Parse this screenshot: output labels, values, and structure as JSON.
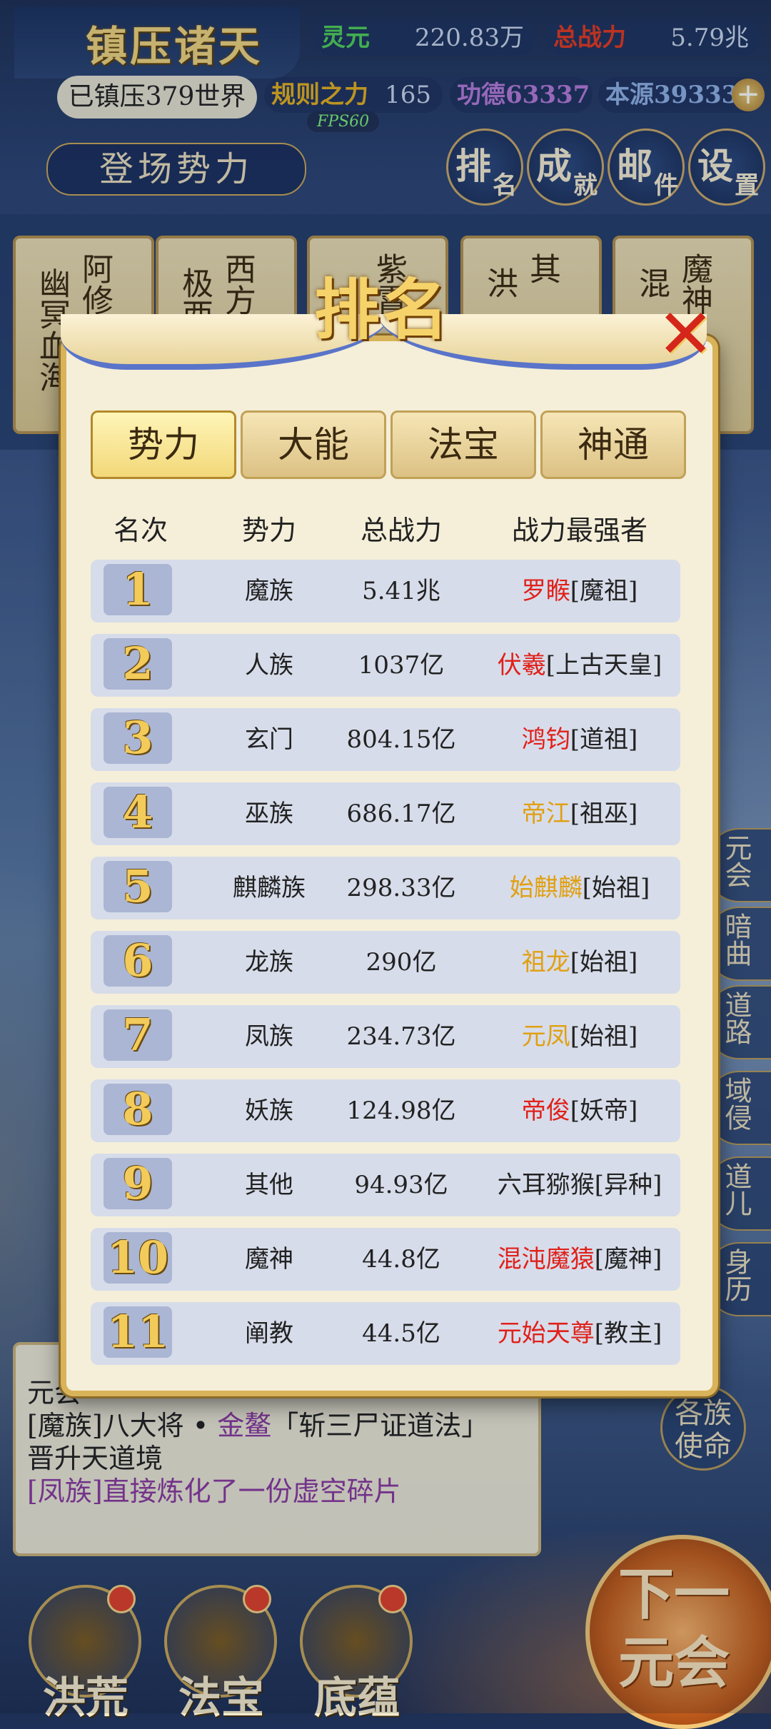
{
  "header": {
    "title": "镇压诸天",
    "suppressed": "已镇压379世界",
    "stats": {
      "lingyuan_label": "灵元",
      "lingyuan_value": "220.83万",
      "total_power_label": "总战力",
      "total_power_value": "5.79兆",
      "rule_label": "规则之力",
      "rule_value": "165",
      "merit": "功德63337",
      "origin": "本源39333"
    },
    "fps": "FPS60",
    "deploy_button": "登场势力",
    "nav": [
      {
        "a": "排",
        "b": "名"
      },
      {
        "a": "成",
        "b": "就"
      },
      {
        "a": "邮",
        "b": "件"
      },
      {
        "a": "设",
        "b": "置"
      }
    ]
  },
  "worlds": [
    {
      "c1": "幽冥血海",
      "c2": "阿修"
    },
    {
      "c1": "极西",
      "c2": "西方"
    },
    {
      "c1": "",
      "c2": "紫霄"
    },
    {
      "c1": "洪",
      "c2": "其"
    },
    {
      "c1": "混",
      "c2": "魔神"
    }
  ],
  "side_buttons": [
    "元会",
    "暗曲",
    "道路",
    "域侵",
    "道儿",
    "身历"
  ],
  "side_big": "各族使命",
  "log": {
    "line1": "[魔族]八大将 • ",
    "line1_name": "金鳌",
    "line1_rest": "「斩三尸证道法」",
    "line2": "晋升天道境",
    "line3": "[凤族]直接炼化了一份虚空碎片",
    "line0": "元会"
  },
  "bottom": [
    "洪荒",
    "法宝",
    "底蕴"
  ],
  "next_button": "下一元会",
  "modal": {
    "title": "排名",
    "tabs": [
      "势力",
      "大能",
      "法宝",
      "神通"
    ],
    "headers": [
      "名次",
      "势力",
      "总战力",
      "战力最强者"
    ],
    "rows": [
      {
        "rank": "1",
        "force": "魔族",
        "power": "5.41兆",
        "name": "罗睺",
        "title": "[魔祖]",
        "color": "red"
      },
      {
        "rank": "2",
        "force": "人族",
        "power": "1037亿",
        "name": "伏羲",
        "title": "[上古天皇]",
        "color": "red"
      },
      {
        "rank": "3",
        "force": "玄门",
        "power": "804.15亿",
        "name": "鸿钧",
        "title": "[道祖]",
        "color": "red"
      },
      {
        "rank": "4",
        "force": "巫族",
        "power": "686.17亿",
        "name": "帝江",
        "title": "[祖巫]",
        "color": "orange"
      },
      {
        "rank": "5",
        "force": "麒麟族",
        "power": "298.33亿",
        "name": "始麒麟",
        "title": "[始祖]",
        "color": "orange"
      },
      {
        "rank": "6",
        "force": "龙族",
        "power": "290亿",
        "name": "祖龙",
        "title": "[始祖]",
        "color": "orange"
      },
      {
        "rank": "7",
        "force": "凤族",
        "power": "234.73亿",
        "name": "元凤",
        "title": "[始祖]",
        "color": "orange"
      },
      {
        "rank": "8",
        "force": "妖族",
        "power": "124.98亿",
        "name": "帝俊",
        "title": "[妖帝]",
        "color": "red"
      },
      {
        "rank": "9",
        "force": "其他",
        "power": "94.93亿",
        "name": "六耳猕猴",
        "title": "[异种]",
        "color": "black"
      },
      {
        "rank": "10",
        "force": "魔神",
        "power": "44.8亿",
        "name": "混沌魔猿",
        "title": "[魔神]",
        "color": "red"
      },
      {
        "rank": "11",
        "force": "阐教",
        "power": "44.5亿",
        "name": "元始天尊",
        "title": "[教主]",
        "color": "red"
      }
    ]
  }
}
